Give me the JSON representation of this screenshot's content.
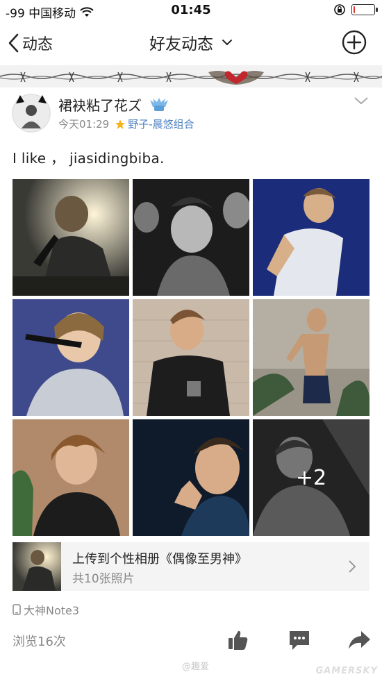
{
  "status_bar": {
    "carrier": "-99 中国移动",
    "time": "01:45",
    "battery_level": 0.08,
    "icons": [
      "wifi-icon",
      "rotation-lock-icon",
      "battery-icon"
    ]
  },
  "nav": {
    "back_label": "动态",
    "title": "好友动态",
    "icons": [
      "chevron-left-icon",
      "chevron-down-icon",
      "plus-circle-icon"
    ]
  },
  "post": {
    "username": "裙袂粘了花ズ",
    "timestamp": "今天01:29",
    "group": "野子-晨悠组合",
    "text": "I like ，  jiasidingbiba.",
    "photos": [
      {
        "label": "photo-1",
        "bg": "#3a3a35"
      },
      {
        "label": "photo-2",
        "bg": "#1c1c1c"
      },
      {
        "label": "photo-3",
        "bg": "#1b2c7a"
      },
      {
        "label": "photo-4",
        "bg": "#3e4a8c"
      },
      {
        "label": "photo-5",
        "bg": "#c9b9a8"
      },
      {
        "label": "photo-6",
        "bg": "#9a9488"
      },
      {
        "label": "photo-7",
        "bg": "#b08a6a"
      },
      {
        "label": "photo-8",
        "bg": "#0f1a2a"
      },
      {
        "label": "photo-9",
        "bg": "#2a2a2a"
      }
    ],
    "more_count": "+2"
  },
  "album": {
    "title": "上传到个性相册《偶像至男神》",
    "subtitle": "共10张照片"
  },
  "device": "大神Note3",
  "views": "浏览16次",
  "actions": [
    "like-icon",
    "comment-icon",
    "share-icon"
  ],
  "watermarks": {
    "center": "@趣爱",
    "corner": "GAMERSKY"
  },
  "colors": {
    "link": "#4a7fc1",
    "battery_low": "#e0332e",
    "secondary_text": "#888888"
  }
}
